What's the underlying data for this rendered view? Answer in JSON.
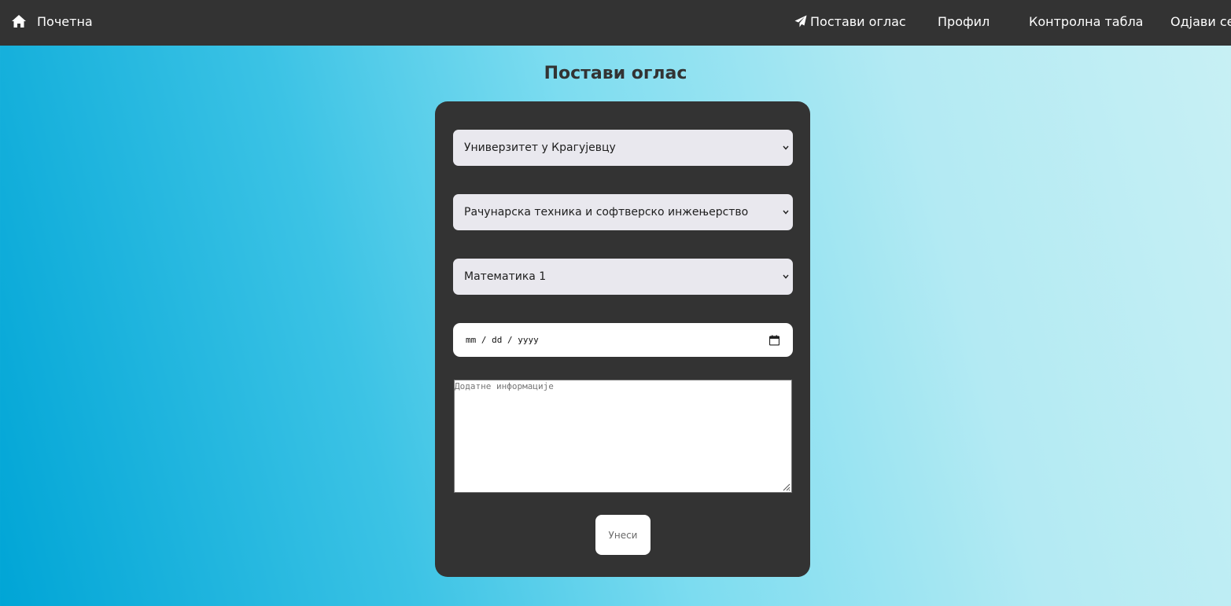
{
  "nav": {
    "home_label": "Почетна",
    "home_icon": "home-icon",
    "post_ad_label": "Постави оглас",
    "post_ad_icon": "paper-plane-icon",
    "profile_label": "Профил",
    "dashboard_label": "Контролна табла",
    "logout_label": "Одјави се"
  },
  "page": {
    "title": "Постави оглас"
  },
  "form": {
    "university": {
      "selected": "Универзитет у Крагујевцу"
    },
    "department": {
      "selected": "Рачунарска техника и софтверско инжењерство"
    },
    "subject": {
      "selected": "Математика 1"
    },
    "date": {
      "placeholder": "mm / dd / yyyy",
      "icon": "calendar-icon"
    },
    "info": {
      "placeholder": "Додатне информације"
    },
    "submit_label": "Унеси"
  },
  "colors": {
    "navbar": "#333333",
    "card": "#333333",
    "select_bg": "#e9e8ee",
    "gradient_start": "#00a5d6",
    "gradient_end": "#c8f0f4"
  }
}
